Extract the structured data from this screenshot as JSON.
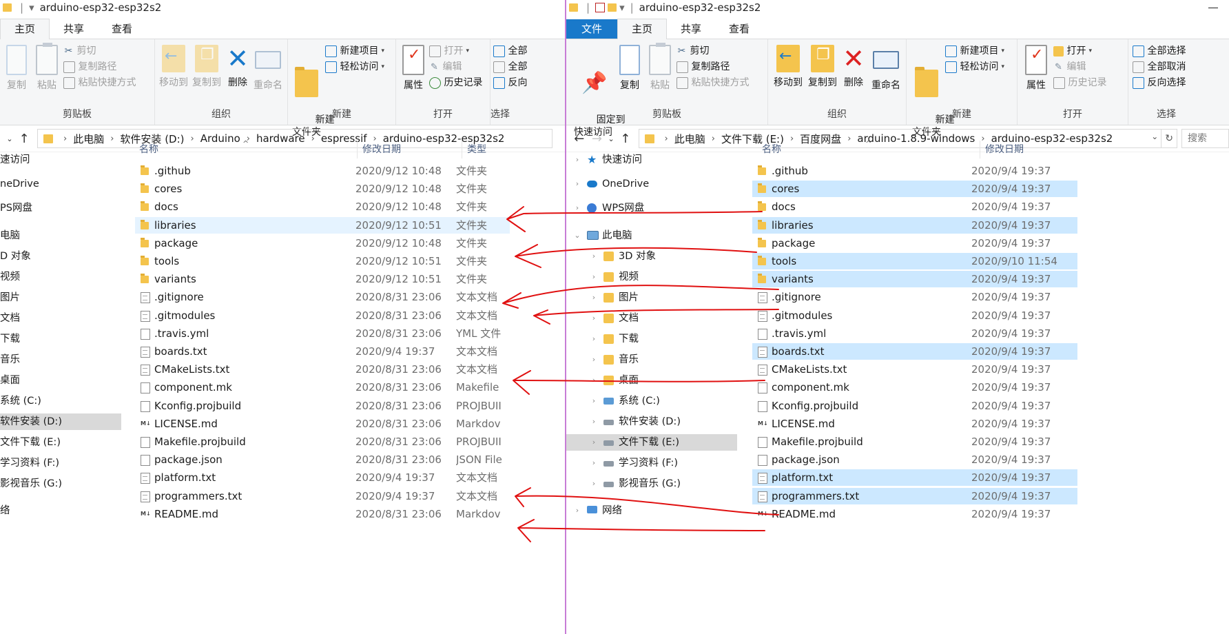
{
  "left": {
    "title": "arduino-esp32-esp32s2",
    "tabs": [
      "主页",
      "共享",
      "查看"
    ],
    "ribbon": {
      "clipboard": {
        "copy": "复制",
        "paste": "粘贴",
        "cut": "剪切",
        "copy_path": "复制路径",
        "paste_shortcut": "粘贴快捷方式",
        "label": "剪贴板"
      },
      "organize": {
        "move_to": "移动到",
        "copy_to": "复制到",
        "delete": "删除",
        "rename": "重命名",
        "label": "组织"
      },
      "new": {
        "new_folder": "新建\n文件夹",
        "new_item": "新建项目",
        "easy_access": "轻松访问",
        "label": "新建"
      },
      "open": {
        "properties": "属性",
        "open": "打开",
        "edit": "编辑",
        "history": "历史记录",
        "label": "打开"
      },
      "select": {
        "select_all": "全部",
        "select_none": "全部",
        "invert": "反向",
        "label": "选择"
      }
    },
    "breadcrumb": [
      "此电脑",
      "软件安装 (D:)",
      "Arduino",
      "hardware",
      "espressif",
      "arduino-esp32-esp32s2"
    ],
    "nav": [
      {
        "label": "速访问",
        "selected": false
      },
      {
        "label": "neDrive",
        "selected": false
      },
      {
        "label": "PS网盘",
        "selected": false
      },
      {
        "label": "电脑",
        "selected": false
      },
      {
        "label": "D 对象",
        "selected": false
      },
      {
        "label": "视频",
        "selected": false
      },
      {
        "label": "图片",
        "selected": false
      },
      {
        "label": "文档",
        "selected": false
      },
      {
        "label": "下载",
        "selected": false
      },
      {
        "label": "音乐",
        "selected": false
      },
      {
        "label": "桌面",
        "selected": false
      },
      {
        "label": "系统 (C:)",
        "selected": false
      },
      {
        "label": "软件安装 (D:)",
        "selected": true
      },
      {
        "label": "文件下载 (E:)",
        "selected": false
      },
      {
        "label": "学习资料 (F:)",
        "selected": false
      },
      {
        "label": "影视音乐 (G:)",
        "selected": false
      },
      {
        "label": "络",
        "selected": false
      }
    ],
    "columns": {
      "name": "名称",
      "date": "修改日期",
      "type": "类型"
    },
    "files": [
      {
        "name": ".github",
        "date": "2020/9/12 10:48",
        "type": "文件夹",
        "icon": "folder",
        "state": ""
      },
      {
        "name": "cores",
        "date": "2020/9/12 10:48",
        "type": "文件夹",
        "icon": "folder",
        "state": ""
      },
      {
        "name": "docs",
        "date": "2020/9/12 10:48",
        "type": "文件夹",
        "icon": "folder",
        "state": ""
      },
      {
        "name": "libraries",
        "date": "2020/9/12 10:51",
        "type": "文件夹",
        "icon": "folder",
        "state": "hover"
      },
      {
        "name": "package",
        "date": "2020/9/12 10:48",
        "type": "文件夹",
        "icon": "folder",
        "state": ""
      },
      {
        "name": "tools",
        "date": "2020/9/12 10:51",
        "type": "文件夹",
        "icon": "folder",
        "state": ""
      },
      {
        "name": "variants",
        "date": "2020/9/12 10:51",
        "type": "文件夹",
        "icon": "folder",
        "state": ""
      },
      {
        "name": ".gitignore",
        "date": "2020/8/31 23:06",
        "type": "文本文档",
        "icon": "doc",
        "state": ""
      },
      {
        "name": ".gitmodules",
        "date": "2020/8/31 23:06",
        "type": "文本文档",
        "icon": "doc",
        "state": ""
      },
      {
        "name": ".travis.yml",
        "date": "2020/8/31 23:06",
        "type": "YML 文件",
        "icon": "blank",
        "state": ""
      },
      {
        "name": "boards.txt",
        "date": "2020/9/4 19:37",
        "type": "文本文档",
        "icon": "doc",
        "state": ""
      },
      {
        "name": "CMakeLists.txt",
        "date": "2020/8/31 23:06",
        "type": "文本文档",
        "icon": "doc",
        "state": ""
      },
      {
        "name": "component.mk",
        "date": "2020/8/31 23:06",
        "type": "Makefile",
        "icon": "blank",
        "state": ""
      },
      {
        "name": "Kconfig.projbuild",
        "date": "2020/8/31 23:06",
        "type": "PROJBUII",
        "icon": "blank",
        "state": ""
      },
      {
        "name": "LICENSE.md",
        "date": "2020/8/31 23:06",
        "type": "Markdov",
        "icon": "md",
        "state": ""
      },
      {
        "name": "Makefile.projbuild",
        "date": "2020/8/31 23:06",
        "type": "PROJBUII",
        "icon": "blank",
        "state": ""
      },
      {
        "name": "package.json",
        "date": "2020/8/31 23:06",
        "type": "JSON File",
        "icon": "blank",
        "state": ""
      },
      {
        "name": "platform.txt",
        "date": "2020/9/4 19:37",
        "type": "文本文档",
        "icon": "doc",
        "state": ""
      },
      {
        "name": "programmers.txt",
        "date": "2020/9/4 19:37",
        "type": "文本文档",
        "icon": "doc",
        "state": ""
      },
      {
        "name": "README.md",
        "date": "2020/8/31 23:06",
        "type": "Markdov",
        "icon": "md",
        "state": ""
      }
    ]
  },
  "right": {
    "title": "arduino-esp32-esp32s2",
    "tabs": [
      "文件",
      "主页",
      "共享",
      "查看"
    ],
    "ribbon": {
      "clipboard": {
        "pin": "固定到\n快速访问",
        "copy": "复制",
        "paste": "粘贴",
        "cut": "剪切",
        "copy_path": "复制路径",
        "paste_shortcut": "粘贴快捷方式",
        "label": "剪贴板"
      },
      "organize": {
        "move_to": "移动到",
        "copy_to": "复制到",
        "delete": "删除",
        "rename": "重命名",
        "label": "组织"
      },
      "new": {
        "new_folder": "新建\n文件夹",
        "new_item": "新建项目",
        "easy_access": "轻松访问",
        "label": "新建"
      },
      "open": {
        "properties": "属性",
        "open": "打开",
        "edit": "编辑",
        "history": "历史记录",
        "label": "打开"
      },
      "select": {
        "select_all": "全部选择",
        "select_none": "全部取消",
        "invert": "反向选择",
        "label": "选择"
      }
    },
    "breadcrumb": [
      "此电脑",
      "文件下载 (E:)",
      "百度网盘",
      "arduino-1.8.9-windows",
      "arduino-esp32-esp32s2"
    ],
    "search_placeholder": "搜索",
    "nav": [
      {
        "label": "快速访问",
        "icon": "star",
        "chev": true,
        "selected": false
      },
      {
        "label": "OneDrive",
        "icon": "cloud",
        "chev": true,
        "selected": false
      },
      {
        "label": "WPS网盘",
        "icon": "wps",
        "chev": true,
        "selected": false
      },
      {
        "label": "此电脑",
        "icon": "pc",
        "chev": "open",
        "selected": false
      },
      {
        "label": "3D 对象",
        "icon": "fold",
        "chev": true,
        "selected": false
      },
      {
        "label": "视频",
        "icon": "fold",
        "chev": true,
        "selected": false
      },
      {
        "label": "图片",
        "icon": "fold",
        "chev": true,
        "selected": false
      },
      {
        "label": "文档",
        "icon": "fold",
        "chev": true,
        "selected": false
      },
      {
        "label": "下载",
        "icon": "fold",
        "chev": true,
        "selected": false
      },
      {
        "label": "音乐",
        "icon": "fold",
        "chev": true,
        "selected": false
      },
      {
        "label": "桌面",
        "icon": "fold",
        "chev": true,
        "selected": false
      },
      {
        "label": "系统 (C:)",
        "icon": "sys",
        "chev": true,
        "selected": false
      },
      {
        "label": "软件安装 (D:)",
        "icon": "drive",
        "chev": true,
        "selected": false
      },
      {
        "label": "文件下载 (E:)",
        "icon": "drive",
        "chev": true,
        "selected": true
      },
      {
        "label": "学习资料 (F:)",
        "icon": "drive",
        "chev": true,
        "selected": false
      },
      {
        "label": "影视音乐 (G:)",
        "icon": "drive",
        "chev": true,
        "selected": false
      },
      {
        "label": "网络",
        "icon": "net",
        "chev": true,
        "selected": false
      }
    ],
    "columns": {
      "name": "名称",
      "date": "修改日期"
    },
    "files": [
      {
        "name": ".github",
        "date": "2020/9/4 19:37",
        "icon": "folder",
        "state": ""
      },
      {
        "name": "cores",
        "date": "2020/9/4 19:37",
        "icon": "folder",
        "state": "sel"
      },
      {
        "name": "docs",
        "date": "2020/9/4 19:37",
        "icon": "folder",
        "state": ""
      },
      {
        "name": "libraries",
        "date": "2020/9/4 19:37",
        "icon": "folder",
        "state": "sel"
      },
      {
        "name": "package",
        "date": "2020/9/4 19:37",
        "icon": "folder",
        "state": ""
      },
      {
        "name": "tools",
        "date": "2020/9/10 11:54",
        "icon": "folder",
        "state": "sel"
      },
      {
        "name": "variants",
        "date": "2020/9/4 19:37",
        "icon": "folder",
        "state": "sel"
      },
      {
        "name": ".gitignore",
        "date": "2020/9/4 19:37",
        "icon": "doc",
        "state": ""
      },
      {
        "name": ".gitmodules",
        "date": "2020/9/4 19:37",
        "icon": "doc",
        "state": ""
      },
      {
        "name": ".travis.yml",
        "date": "2020/9/4 19:37",
        "icon": "blank",
        "state": ""
      },
      {
        "name": "boards.txt",
        "date": "2020/9/4 19:37",
        "icon": "doc",
        "state": "sel"
      },
      {
        "name": "CMakeLists.txt",
        "date": "2020/9/4 19:37",
        "icon": "doc",
        "state": ""
      },
      {
        "name": "component.mk",
        "date": "2020/9/4 19:37",
        "icon": "blank",
        "state": ""
      },
      {
        "name": "Kconfig.projbuild",
        "date": "2020/9/4 19:37",
        "icon": "blank",
        "state": ""
      },
      {
        "name": "LICENSE.md",
        "date": "2020/9/4 19:37",
        "icon": "md",
        "state": ""
      },
      {
        "name": "Makefile.projbuild",
        "date": "2020/9/4 19:37",
        "icon": "blank",
        "state": ""
      },
      {
        "name": "package.json",
        "date": "2020/9/4 19:37",
        "icon": "blank",
        "state": ""
      },
      {
        "name": "platform.txt",
        "date": "2020/9/4 19:37",
        "icon": "doc",
        "state": "sel"
      },
      {
        "name": "programmers.txt",
        "date": "2020/9/4 19:37",
        "icon": "doc",
        "state": "sel"
      },
      {
        "name": "README.md",
        "date": "2020/9/4 19:37",
        "icon": "md",
        "state": ""
      }
    ]
  },
  "colors": {
    "accent": "#1979ca",
    "selection": "#cce8ff",
    "annotation": "#e01010",
    "divider": "#c77cd6"
  }
}
